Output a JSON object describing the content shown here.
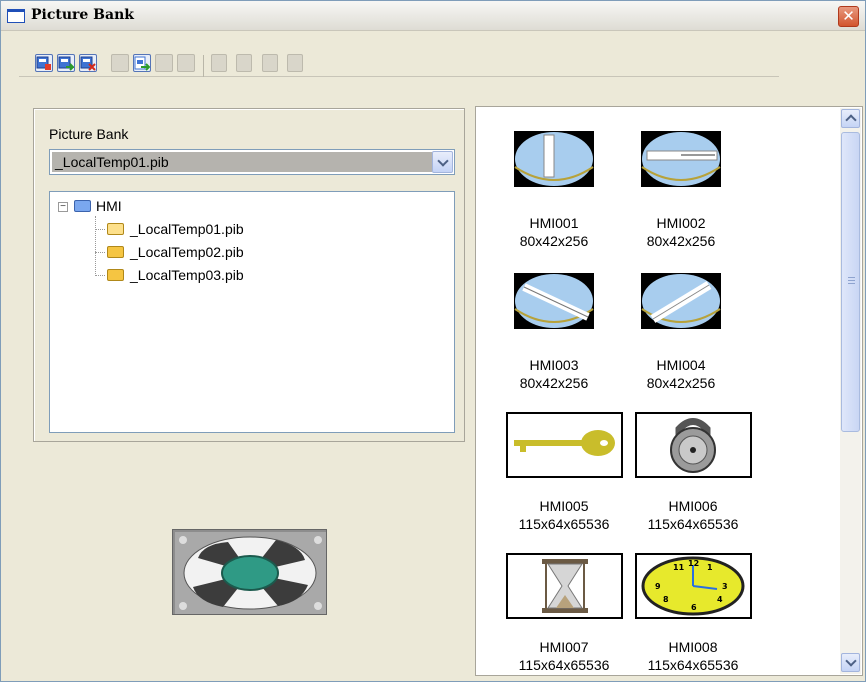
{
  "window": {
    "title": "Picture Bank",
    "close_label": "✕"
  },
  "toolbar": {
    "buttons": [
      {
        "icon": "new-bank-icon",
        "state": "enabled"
      },
      {
        "icon": "import-icon",
        "state": "enabled"
      },
      {
        "icon": "delete-bank-icon",
        "state": "enabled"
      },
      {
        "icon": "copy-icon",
        "state": "disabled"
      },
      {
        "icon": "import-picture-icon",
        "state": "enabled"
      },
      {
        "icon": "export-icon",
        "state": "disabled"
      },
      {
        "icon": "delete-picture-icon",
        "state": "disabled"
      },
      {
        "icon": "view-large-icon",
        "state": "disabled"
      },
      {
        "icon": "view-small-icon",
        "state": "disabled"
      },
      {
        "icon": "view-list-icon",
        "state": "disabled"
      },
      {
        "icon": "view-details-icon",
        "state": "disabled"
      }
    ]
  },
  "left": {
    "label": "Picture Bank",
    "selected_bank": "_LocalTemp01.pib",
    "tree": {
      "root": {
        "label": "HMI",
        "expander": "−"
      },
      "children": [
        {
          "label": "_LocalTemp01.pib",
          "open": true
        },
        {
          "label": "_LocalTemp02.pib",
          "open": false
        },
        {
          "label": "_LocalTemp03.pib",
          "open": false
        }
      ]
    }
  },
  "gallery": {
    "items": [
      {
        "name": "HMI001",
        "size": "80x42x256"
      },
      {
        "name": "HMI002",
        "size": "80x42x256"
      },
      {
        "name": "HMI003",
        "size": "80x42x256"
      },
      {
        "name": "HMI004",
        "size": "80x42x256"
      },
      {
        "name": "HMI005",
        "size": "115x64x65536"
      },
      {
        "name": "HMI006",
        "size": "115x64x65536"
      },
      {
        "name": "HMI007",
        "size": "115x64x65536"
      },
      {
        "name": "HMI008",
        "size": "115x64x65536"
      }
    ]
  },
  "colors": {
    "accent": "#316ac5",
    "panel": "#ece9d8",
    "key": "#c9bd2b",
    "clock": "#e7e92c",
    "fan": "#2f9a85"
  }
}
